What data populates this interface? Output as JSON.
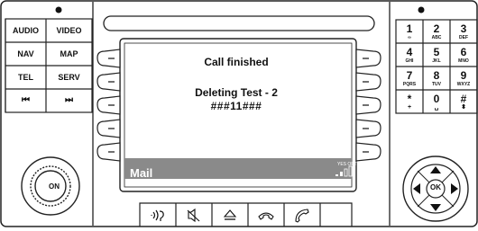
{
  "left_panel": {
    "buttons": {
      "audio": "AUDIO",
      "video": "VIDEO",
      "nav": "NAV",
      "map": "MAP",
      "tel": "TEL",
      "serv": "SERV",
      "prev": "⏮",
      "next": "⏭"
    },
    "power_knob_label": "ON"
  },
  "display": {
    "title": "Call finished",
    "line1": "Deleting Test - 2",
    "line2": "###11###",
    "status_bar": {
      "label": "Mail",
      "small_text": "YES OPTU"
    }
  },
  "keypad": {
    "keys": [
      {
        "digit": "1",
        "sub": "∞"
      },
      {
        "digit": "2",
        "sub": "ABC"
      },
      {
        "digit": "3",
        "sub": "DEF"
      },
      {
        "digit": "4",
        "sub": "GHI"
      },
      {
        "digit": "5",
        "sub": "JKL"
      },
      {
        "digit": "6",
        "sub": "MNO"
      },
      {
        "digit": "7",
        "sub": "PQRS"
      },
      {
        "digit": "8",
        "sub": "TUV"
      },
      {
        "digit": "9",
        "sub": "WXYZ"
      },
      {
        "digit": "*",
        "sub": "+"
      },
      {
        "digit": "0",
        "sub": "␣"
      },
      {
        "digit": "#",
        "sub": "⬍"
      }
    ]
  },
  "controller": {
    "ok_label": "OK"
  },
  "bottom_bar": {
    "icons": [
      "voice-control-icon",
      "mute-icon",
      "eject-icon",
      "hang-up-icon",
      "call-icon"
    ]
  },
  "colors": {
    "status_bar": "#8a8a8a",
    "screen": "#ffffff",
    "outline": "#222222"
  }
}
